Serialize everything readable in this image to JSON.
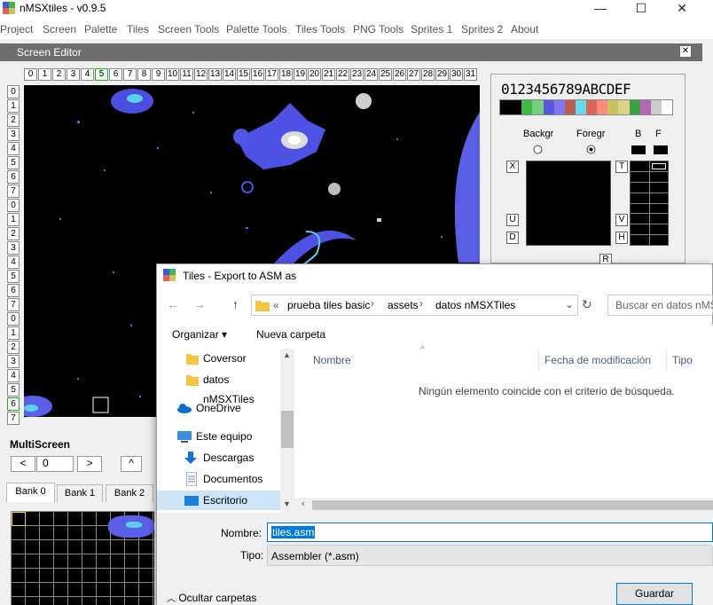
{
  "app": {
    "title": "nMSXtiles - v0.9.5",
    "minimize": "—",
    "maximize": "☐",
    "close": "✕"
  },
  "menu": [
    "Project",
    "Screen",
    "Palette",
    "Tiles",
    "Screen Tools",
    "Palette Tools",
    "Tiles Tools",
    "PNG Tools",
    "Sprites 1",
    "Sprites 2",
    "About"
  ],
  "editor": {
    "title": "Screen Editor",
    "close": "✕",
    "columns": [
      "0",
      "1",
      "2",
      "3",
      "4",
      "5",
      "6",
      "7",
      "8",
      "9",
      "10",
      "11",
      "12",
      "13",
      "14",
      "15",
      "16",
      "17",
      "18",
      "19",
      "20",
      "21",
      "22",
      "23",
      "24",
      "25",
      "26",
      "27",
      "28",
      "29",
      "30",
      "31"
    ],
    "selected_column": "5",
    "rows": [
      "0",
      "1",
      "2",
      "3",
      "4",
      "5",
      "6",
      "7",
      "0",
      "1",
      "2",
      "3",
      "4",
      "5",
      "6",
      "7",
      "0",
      "1",
      "2",
      "3",
      "4",
      "5",
      "6",
      "7"
    ],
    "selected_row_index": 22
  },
  "palette": {
    "hex_digits": "0123456789ABCDEF",
    "swatch_colors": [
      "#000000",
      "#000000",
      "#3eb849",
      "#74d07d",
      "#5955e0",
      "#8076f1",
      "#b95e51",
      "#65dbef",
      "#db6559",
      "#ff897d",
      "#ccc35e",
      "#ded087",
      "#3aa241",
      "#b766b5",
      "#cccccc",
      "#ffffff"
    ],
    "backgr_label": "Backgr",
    "foregr_label": "Foregr",
    "b_label": "B",
    "f_label": "F",
    "x_btn": "X",
    "t_btn": "T",
    "u_btn": "U",
    "v_btn": "V",
    "d_btn": "D",
    "h_btn": "H",
    "r_btn": "R"
  },
  "multiscreen": {
    "title": "MultiScreen",
    "prev": "<",
    "value": "0",
    "next": ">",
    "up": "^",
    "banks": [
      "Bank 0",
      "Bank 1",
      "Bank 2"
    ]
  },
  "dialog": {
    "title": "Tiles - Export to ASM as",
    "path_prefix": "«",
    "path": [
      "prueba tiles basic",
      "assets",
      "datos nMSXTiles"
    ],
    "search_placeholder": "Buscar en datos nMSXTiles",
    "organize": "Organizar",
    "new_folder": "Nueva carpeta",
    "nav_items": [
      "Coversor",
      "datos nMSXTiles",
      "OneDrive",
      "Este equipo",
      "Descargas",
      "Documentos",
      "Escritorio"
    ],
    "col_name": "Nombre",
    "col_date": "Fecha de modificación",
    "col_type": "Tipo",
    "empty_message": "Ningún elemento coincide con el criterio de búsqueda.",
    "name_label": "Nombre:",
    "name_value": "tiles.asm",
    "type_label": "Tipo:",
    "type_value": "Assembler (*.asm)",
    "hide_folders": "Ocultar carpetas",
    "save": "Guardar"
  }
}
